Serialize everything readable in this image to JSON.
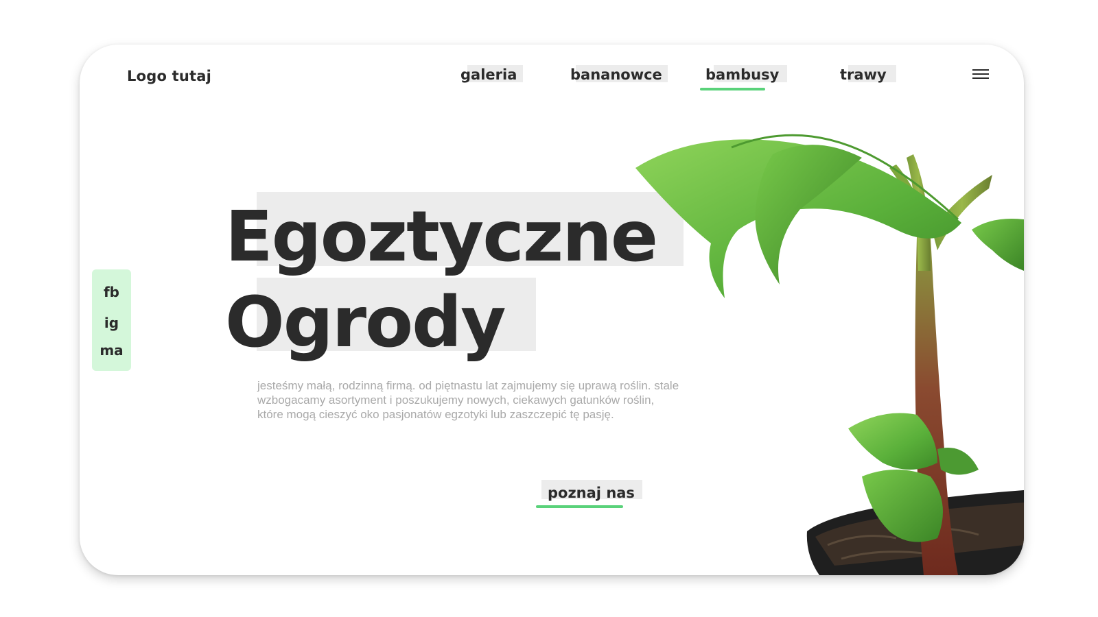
{
  "header": {
    "logo": "Logo tutaj",
    "nav": [
      {
        "label": "galeria",
        "active": false
      },
      {
        "label": "bananowce",
        "active": false
      },
      {
        "label": "bambusy",
        "active": true
      },
      {
        "label": "trawy",
        "active": false
      }
    ],
    "menu_icon": "hamburger-menu-icon"
  },
  "social": {
    "items": [
      "fb",
      "ig",
      "ma"
    ]
  },
  "hero": {
    "title_line1": "Egoztyczne",
    "title_line2": "Ogrody",
    "description": "jesteśmy małą, rodzinną firmą.  od piętnastu lat zajmujemy się uprawą roślin. stale wzbogacamy asortyment i poszukujemy nowych, ciekawych gatunków roślin, które mogą cieszyć oko pasjonatów egzotyki lub zaszczepić tę pasję.",
    "cta": "poznaj nas"
  },
  "colors": {
    "accent": "#5ad27a",
    "highlight": "#ececec",
    "social_bg": "#d4f7da",
    "text": "#2b2b2b",
    "muted": "#a9a9a9"
  }
}
